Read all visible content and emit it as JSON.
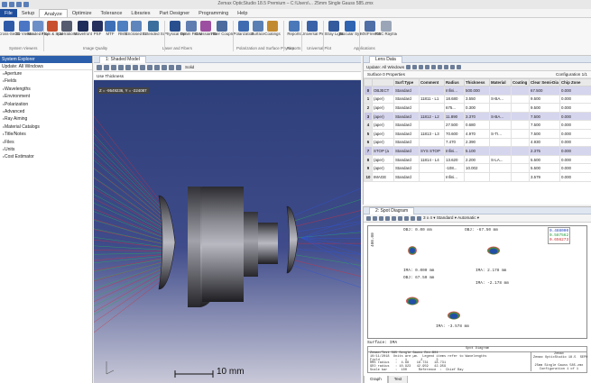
{
  "window": {
    "title": "Zemax OpticStudio 18.5    Premium – C:\\Users\\... 25mm Single Gauss 585.zmx"
  },
  "menu": [
    "File",
    "Setup",
    "Analyze",
    "Optimize",
    "Tolerance",
    "Libraries",
    "Part Designer",
    "Programming",
    "Help"
  ],
  "menu_active": "Analyze",
  "ribbon": {
    "buttons": [
      {
        "label": "Cross-Section",
        "icon": "cross-section-icon",
        "color": "#2f5aa8"
      },
      {
        "label": "3D Viewer",
        "icon": "3d-viewer-icon",
        "color": "#4a76c4"
      },
      {
        "label": "Shaded Model",
        "icon": "shaded-model-icon",
        "color": "#6d8fc8"
      },
      {
        "label": "Rays & Spots",
        "icon": "rays-spots-icon",
        "color": "#c8502e"
      },
      {
        "label": "Aberrations",
        "icon": "aberrations-icon",
        "color": "#555c70"
      },
      {
        "label": "Wavefront",
        "icon": "wavefront-icon",
        "color": "#1f2e5a"
      },
      {
        "label": "PSF",
        "icon": "psf-icon",
        "color": "#26305f"
      },
      {
        "label": "MTF",
        "icon": "mtf-icon",
        "color": "#3d6fb6"
      },
      {
        "label": "RMS",
        "icon": "rms-icon",
        "color": "#4e7fc0"
      },
      {
        "label": "Enclosed Energy",
        "icon": "enclosed-energy-icon",
        "color": "#5e86bd"
      },
      {
        "label": "Extended Scene Analysis",
        "icon": "extended-scene-icon",
        "color": "#3a6e9c"
      },
      {
        "label": "Physical Optics",
        "icon": "physical-optics-icon",
        "color": "#2a4f8f"
      },
      {
        "label": "Beam File Viewer",
        "icon": "beam-file-icon",
        "color": "#5f7db0"
      },
      {
        "label": "Gaussian Beams",
        "icon": "gaussian-beams-icon",
        "color": "#9c4fa0"
      },
      {
        "label": "Fiber Coupling",
        "icon": "fiber-coupling-icon",
        "color": "#4d6c9d"
      },
      {
        "label": "Polarization",
        "icon": "polarization-icon",
        "color": "#3f6cb1"
      },
      {
        "label": "Surface",
        "icon": "surface-icon",
        "color": "#5a7fb5"
      },
      {
        "label": "Coatings",
        "icon": "coatings-icon",
        "color": "#c28a2f"
      },
      {
        "label": "Reports",
        "icon": "reports-icon",
        "color": "#4a78b9"
      },
      {
        "label": "Universal Plot",
        "icon": "universal-plot-icon",
        "color": "#3b63a7"
      },
      {
        "label": "Stray Light",
        "icon": "stray-light-icon",
        "color": "#335a9c"
      },
      {
        "label": "Biocular Systems",
        "icon": "biocular-icon",
        "color": "#2f64b0"
      },
      {
        "label": "IMX/Freeform",
        "icon": "imx-freeform-icon",
        "color": "#4f6fa6"
      },
      {
        "label": "RSC Raytracing",
        "icon": "rsc-raytracing-icon",
        "color": "#9aa6b8"
      }
    ],
    "groups": [
      "System Viewers",
      "Image Quality",
      "Laser and Fibers",
      "Polarization and Surface Physics",
      "Reports",
      "Universal Plot",
      "Applications"
    ]
  },
  "system_explorer": {
    "title": "System Explorer",
    "update": "Update: All Windows",
    "items": [
      "Aperture",
      "Fields",
      "Wavelengths",
      "Environment",
      "Polarization",
      "Advanced",
      "Ray Aiming",
      "Material Catalogs",
      "Title/Notes",
      "Files",
      "Units",
      "Cost Estimator"
    ]
  },
  "viewer": {
    "tab": "1: Shaded Model",
    "toolbar_label": "Solid",
    "option": "Use Thickness",
    "coord": "Z = -9549236, Y = -224087",
    "scale": "10 mm"
  },
  "lens": {
    "tab": "Lens Data",
    "update": "Update: All Windows",
    "surface_props": "Surface 0 Properties",
    "config": "Configuration 1/1",
    "columns": [
      "Surf:Type",
      "Comment",
      "Radius",
      "Thickness",
      "Material",
      "Coating",
      "Clear Semi-Dia",
      "Chip Zone"
    ],
    "rows": [
      {
        "n": "0",
        "name": "OBJECT",
        "type": "Standard",
        "comment": "",
        "radius": "Infini...",
        "thickness": "500.000",
        "material": "",
        "semi": "67.500",
        "flag": "U",
        "chip": "0.000"
      },
      {
        "n": "1",
        "name": "(aper)",
        "type": "Standard",
        "comment": "11811 - L1",
        "radius": "18.680",
        "thickness": "3.550",
        "material": "S-BA...",
        "semi": "9.500",
        "flag": "U",
        "chip": "0.000"
      },
      {
        "n": "2",
        "name": "(aper)",
        "type": "Standard",
        "comment": "",
        "radius": "675...",
        "thickness": "0.300",
        "material": "",
        "semi": "9.500",
        "flag": "U",
        "chip": "0.000"
      },
      {
        "n": "3",
        "name": "(aper)",
        "type": "Standard",
        "comment": "11812 - L2",
        "radius": "11.890",
        "thickness": "3.370",
        "material": "S-BA...",
        "semi": "7.500",
        "flag": "U",
        "chip": "0.000"
      },
      {
        "n": "4",
        "name": "(aper)",
        "type": "Standard",
        "comment": "",
        "radius": "27.500",
        "thickness": "0.680",
        "material": "",
        "semi": "7.500",
        "flag": "U",
        "chip": "0.000"
      },
      {
        "n": "5",
        "name": "(aper)",
        "type": "Standard",
        "comment": "11813 - L3",
        "radius": "70.600",
        "thickness": "4.970",
        "material": "S-TI...",
        "semi": "7.500",
        "flag": "U",
        "chip": "0.000"
      },
      {
        "n": "6",
        "name": "(aper)",
        "type": "Standard",
        "comment": "",
        "radius": "7.470",
        "thickness": "2.390",
        "material": "",
        "semi": "4.930",
        "flag": "U",
        "chip": "0.000"
      },
      {
        "n": "7",
        "name": "STOP (a",
        "type": "Standard",
        "comment": "SYS STOP",
        "radius": "Infini...",
        "thickness": "5.100",
        "material": "",
        "semi": "2.375",
        "flag": "U",
        "chip": "0.000"
      },
      {
        "n": "8",
        "name": "(aper)",
        "type": "Standard",
        "comment": "11814 - L4",
        "radius": "13.620",
        "thickness": "2.200",
        "material": "S-LA...",
        "semi": "5.500",
        "flag": "U",
        "chip": "0.000"
      },
      {
        "n": "9",
        "name": "(aper)",
        "type": "Standard",
        "comment": "",
        "radius": "-108...",
        "thickness": "10.002",
        "material": "",
        "semi": "5.500",
        "flag": "U",
        "chip": "0.000"
      },
      {
        "n": "10",
        "name": "IMAGE",
        "type": "Standard",
        "comment": "",
        "radius": "Infini...",
        "thickness": "",
        "material": "",
        "semi": "3.579",
        "flag": "",
        "chip": "0.000"
      }
    ]
  },
  "spot": {
    "tab": "2: Spot Diagram",
    "toolbar_text": "3 x 4 ▾  Standard ▾  Automatic ▾",
    "fields": [
      {
        "obj": "OBJ: 0.00 mm",
        "ima": "IMA: 0.000 mm"
      },
      {
        "obj": "OBJ: -67.50 mm",
        "ima": "IMA: 2.178 mm"
      },
      {
        "obj": "OBJ: 67.50 mm",
        "ima": "IMA: -2.178 mm"
      },
      {
        "obj": "OBJ: 67.50 mm",
        "ima": "IMA: -3.578 mm"
      }
    ],
    "axis_label": "400.00",
    "legend": [
      "0.488000",
      "0.587562",
      "0.656273"
    ],
    "surface": "Surface: IMA",
    "footer_title": "Spot Diagram",
    "footer_left": "Zemax/Test 585 Single Gauss Rev-B04\n10/11/2018  Units are µm.  Legend items refer to Wavelengths\nField        :    1       2       3\nRMS radius   :  4.68    18.731   18.731\nGEO radius   : 10.923   42.959   42.959\nScale bar    :  100      Reference  :  Chief Ray",
    "footer_right": "Zemax\nZemax OpticStudio 18.5  SEPH\n\n25mm Single Gauss 585.zmx\nConfiguration 1 of 1",
    "bottom_tabs": [
      "Graph",
      "Text"
    ]
  }
}
